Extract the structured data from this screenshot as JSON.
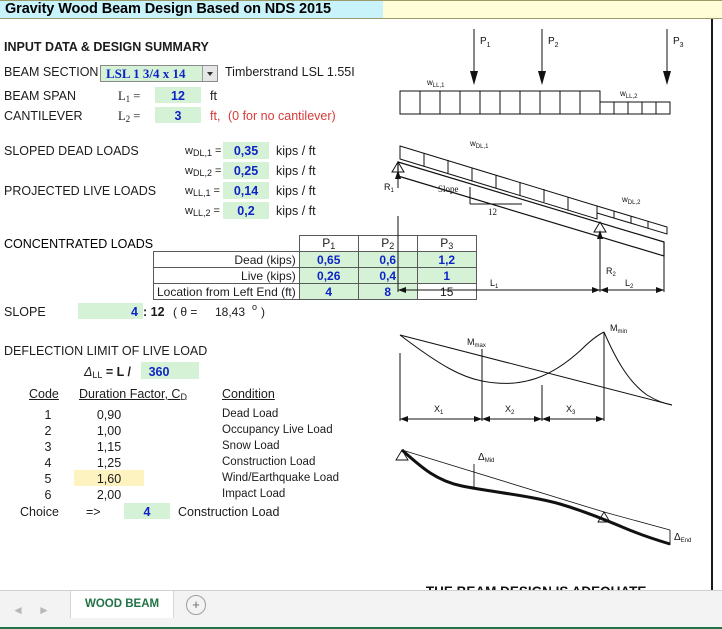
{
  "title_bar": {
    "title": "Gravity Wood Beam Design Based on NDS 2015"
  },
  "input_section": {
    "heading": "INPUT DATA & DESIGN SUMMARY",
    "beam_section_label": "BEAM SECTION",
    "beam_section_value": "LSL 1 3/4 x 14",
    "beam_section_note": "Timberstrand LSL 1.55I",
    "beam_span_label": "BEAM SPAN",
    "beam_span_symbol": "L",
    "beam_span_sub": "1",
    "beam_span_eq": "=",
    "beam_span_value": "12",
    "beam_span_unit": "ft",
    "cantilever_label": "CANTILEVER",
    "cantilever_symbol": "L",
    "cantilever_sub": "2",
    "cantilever_eq": "=",
    "cantilever_value": "3",
    "cantilever_unit": "ft,",
    "cantilever_note": "(0 for no cantilever)"
  },
  "loads": {
    "sloped_dead_label": "SLOPED DEAD LOADS",
    "projected_live_label": "PROJECTED LIVE LOADS",
    "unit": "kips / ft",
    "rows": [
      {
        "symbol": "w",
        "sub": "DL,1",
        "eq": "=",
        "value": "0,35"
      },
      {
        "symbol": "w",
        "sub": "DL,2",
        "eq": "=",
        "value": "0,25"
      },
      {
        "symbol": "w",
        "sub": "LL,1",
        "eq": "=",
        "value": "0,14"
      },
      {
        "symbol": "w",
        "sub": "LL,2",
        "eq": "=",
        "value": "0,2"
      }
    ]
  },
  "concentrated": {
    "title": "CONCENTRATED LOADS",
    "col_headers": [
      "P",
      "P",
      "P"
    ],
    "col_subs": [
      "1",
      "2",
      "3"
    ],
    "rows": [
      {
        "label": "Dead (kips)",
        "values": [
          "0,65",
          "0,6",
          "1,2"
        ],
        "kinds": [
          "inp",
          "inp",
          "inp"
        ]
      },
      {
        "label": "Live (kips)",
        "values": [
          "0,26",
          "0,4",
          "1"
        ],
        "kinds": [
          "inp",
          "inp",
          "inp"
        ]
      },
      {
        "label": "Location from Left End (ft)",
        "values": [
          "4",
          "8",
          "15"
        ],
        "kinds": [
          "inp",
          "inp",
          "calc"
        ]
      }
    ]
  },
  "slope": {
    "label": "SLOPE",
    "rise": "4",
    "run_text": ": 12",
    "theta_prefix": "( θ =",
    "theta_value": "18,43",
    "degree": "o",
    "theta_suffix": ")"
  },
  "deflection": {
    "heading": "DEFLECTION LIMIT OF LIVE LOAD",
    "symbol": "Δ",
    "sub": "LL",
    "formula": "= L /",
    "value": "360"
  },
  "duration_table": {
    "headers": [
      "Code",
      "Duration Factor, C",
      "Condition"
    ],
    "header_sub": "D",
    "rows": [
      {
        "code": "1",
        "factor": "0,90",
        "condition": "Dead Load",
        "highlight": false
      },
      {
        "code": "2",
        "factor": "1,00",
        "condition": "Occupancy Live Load",
        "highlight": false
      },
      {
        "code": "3",
        "factor": "1,15",
        "condition": "Snow Load",
        "highlight": false
      },
      {
        "code": "4",
        "factor": "1,25",
        "condition": "Construction Load",
        "highlight": false
      },
      {
        "code": "5",
        "factor": "1,60",
        "condition": "Wind/Earthquake Load",
        "highlight": true
      },
      {
        "code": "6",
        "factor": "2,00",
        "condition": "Impact Load",
        "highlight": false
      }
    ],
    "choice_label": "Choice",
    "choice_arrow": "=>",
    "choice_value": "4",
    "choice_condition": "Construction Load"
  },
  "diagram": {
    "load_diagram": {
      "point_loads": [
        "P",
        "P",
        "P"
      ],
      "point_subs": [
        "1",
        "2",
        "3"
      ],
      "dist_labels": [
        {
          "symbol": "w",
          "sub": "LL,1"
        },
        {
          "symbol": "w",
          "sub": "LL,2"
        }
      ]
    },
    "beam_diagram": {
      "dist_labels": [
        {
          "symbol": "w",
          "sub": "DL,1"
        },
        {
          "symbol": "w",
          "sub": "DL,2"
        }
      ],
      "reactions": [
        {
          "symbol": "R",
          "sub": "1"
        },
        {
          "symbol": "R",
          "sub": "2"
        }
      ],
      "slope_label": "Slope",
      "slope_run": "12",
      "spans": [
        {
          "symbol": "L",
          "sub": "1"
        },
        {
          "symbol": "L",
          "sub": "2"
        }
      ]
    },
    "moment_diagram": {
      "labels": [
        {
          "symbol": "M",
          "sub": "max"
        },
        {
          "symbol": "M",
          "sub": "min"
        }
      ],
      "dims": [
        {
          "symbol": "X",
          "sub": "1"
        },
        {
          "symbol": "X",
          "sub": "2"
        },
        {
          "symbol": "X",
          "sub": "3"
        }
      ]
    },
    "deflection_diagram": {
      "labels": [
        {
          "symbol": "Δ",
          "sub": "Mid"
        },
        {
          "symbol": "Δ",
          "sub": "End"
        }
      ]
    }
  },
  "verdict": {
    "text": "THE BEAM DESIGN IS ADEQUATE."
  },
  "tabbar": {
    "prev_arrow": "◄",
    "next_arrow": "►",
    "sheet_tab": "WOOD BEAM",
    "add_sheet": "+"
  },
  "colors": {
    "title_cyan": "#c9f3fb",
    "title_yellow": "#fffdd8",
    "input_green": "#d6f2d6",
    "highlight_yellow": "#fdf3c0",
    "value_blue": "#0d25c6",
    "note_red": "#d63b3b",
    "tab_green": "#217346"
  }
}
